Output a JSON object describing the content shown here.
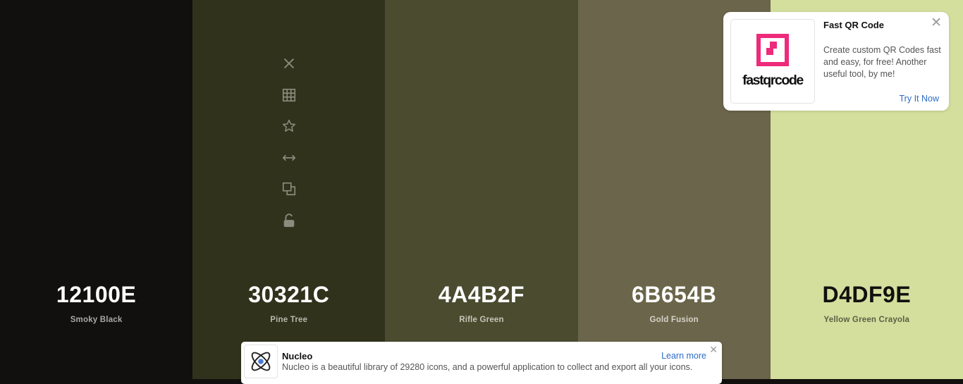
{
  "palette": {
    "swatches": [
      {
        "hex": "12100E",
        "name": "Smoky Black",
        "bg": "#12100E",
        "hex_color": "#ffffff",
        "name_color": "#a8a8a8"
      },
      {
        "hex": "30321C",
        "name": "Pine Tree",
        "bg": "#30321C",
        "hex_color": "#ffffff",
        "name_color": "#b8b8ad"
      },
      {
        "hex": "4A4B2F",
        "name": "Rifle Green",
        "bg": "#4A4B2F",
        "hex_color": "#ffffff",
        "name_color": "#c6c6ba"
      },
      {
        "hex": "6B654B",
        "name": "Gold Fusion",
        "bg": "#6B654B",
        "hex_color": "#ffffff",
        "name_color": "#d6d3c8"
      },
      {
        "hex": "D4DF9E",
        "name": "Yellow Green Crayola",
        "bg": "#D4DF9E",
        "hex_color": "#12100E",
        "name_color": "#5b5f44"
      }
    ],
    "tool_icon_color": "#8c8c7e",
    "tools": [
      "close-icon",
      "grid-icon",
      "star-icon",
      "arrows-horizontal-icon",
      "copy-icon",
      "lock-open-icon"
    ]
  },
  "ad": {
    "title": "Fast QR Code",
    "description": "Create custom QR Codes fast and easy, for free! Another useful tool, by me!",
    "cta": "Try It Now",
    "close": "✕",
    "logo_wordmark": "fastqrcode",
    "logo_color": "#ee2a7b"
  },
  "banner": {
    "title": "Nucleo",
    "text": "Nucleo is a beautiful library of 29280 icons, and a powerful application to collect and export all your icons.",
    "link": "Learn more",
    "close": "✕"
  }
}
